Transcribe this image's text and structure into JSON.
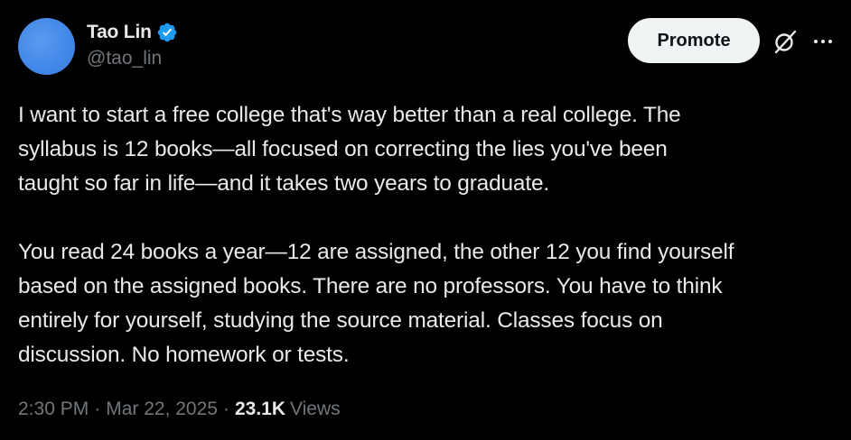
{
  "author": {
    "display_name": "Tao Lin",
    "handle": "@tao_lin",
    "avatar_color": "#4287e8",
    "verified_icon": "verified-badge-icon",
    "verified_color": "#1d9bf0"
  },
  "header": {
    "promote_label": "Promote",
    "grok_icon": "grok-icon",
    "more_icon": "more-options-icon"
  },
  "post": {
    "lines_para1": [
      "I want to start a free college that's way better than a real college. The",
      "syllabus is 12 books—all focused on correcting the lies you've been",
      "taught so far in life—and it takes two years to graduate."
    ],
    "lines_para2": [
      "You read 24 books a year—12 are assigned, the other 12 you find yourself",
      "based on the assigned books. There are no professors. You have to think",
      "entirely for yourself, studying the source material. Classes focus on",
      "discussion. No homework or tests."
    ]
  },
  "meta": {
    "time": "2:30 PM",
    "separator": "·",
    "date": "Mar 22, 2025",
    "views_count": "23.1K",
    "views_label": "Views"
  },
  "colors": {
    "background": "#000000",
    "text_primary": "#e7e9ea",
    "text_secondary": "#71767b",
    "button_bg": "#eff3f4",
    "button_text": "#0f1419"
  }
}
